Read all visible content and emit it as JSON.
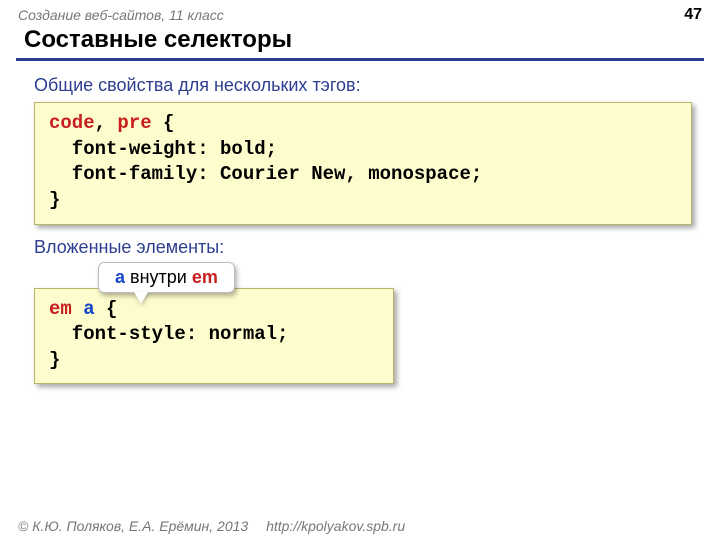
{
  "header": {
    "course": "Создание веб-сайтов, 11 класс",
    "page_number": "47"
  },
  "title": "Составные селекторы",
  "sections": {
    "group": {
      "label": "Общие свойства для нескольких тэгов:",
      "code": {
        "sel1": "code",
        "comma": ", ",
        "sel2": "pre",
        "open": " {",
        "line1": "  font-weight: bold;",
        "line2": "  font-family: Courier New, monospace;",
        "close": "}"
      }
    },
    "nested": {
      "label": "Вложенные элементы:",
      "callout": {
        "a": "a",
        "mid": " внутри ",
        "em": "em"
      },
      "code": {
        "sel1": "em",
        "space": " ",
        "sel2": "a",
        "open": " {",
        "line1": "  font-style: normal;",
        "close": "}"
      }
    }
  },
  "footer": {
    "copyright": "© К.Ю. Поляков, Е.А. Ерёмин, 2013",
    "url": "http://kpolyakov.spb.ru"
  }
}
